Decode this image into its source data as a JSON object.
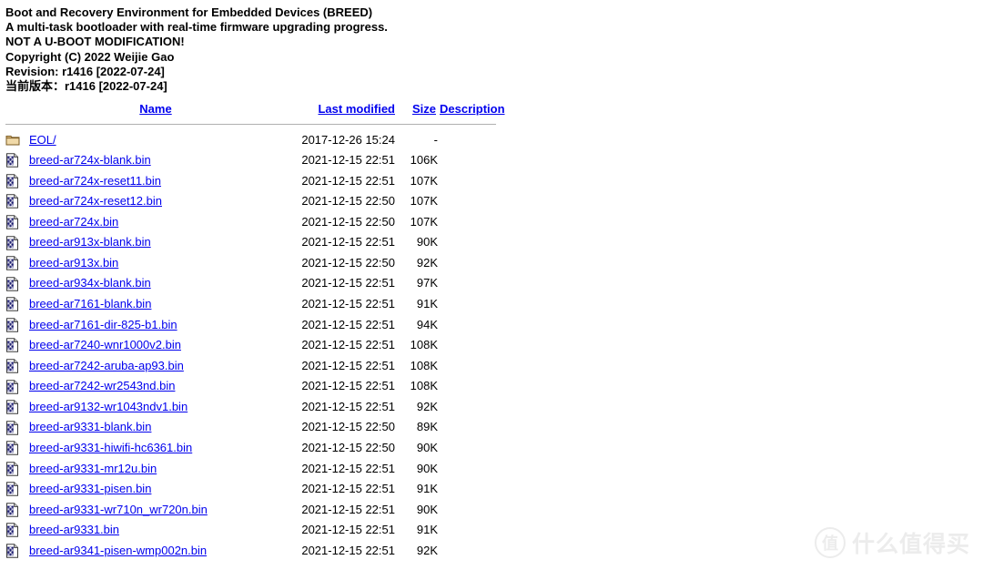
{
  "banner": {
    "lines": [
      "Boot and Recovery Environment for Embedded Devices (BREED)",
      "A multi-task bootloader with real-time firmware upgrading progress.",
      "NOT A U-BOOT MODIFICATION!",
      "Copyright (C) 2022 Weijie Gao",
      "Revision: r1416 [2022-07-24]",
      "当前版本：r1416 [2022-07-24]"
    ]
  },
  "table": {
    "headers": {
      "icon": "",
      "name": "Name",
      "last_modified": "Last modified",
      "size": "Size",
      "description": "Description"
    },
    "rows": [
      {
        "icon": "folder-icon",
        "name": "EOL/",
        "last_modified": "2017-12-26 15:24",
        "size": "-",
        "description": ""
      },
      {
        "icon": "binary-file-icon",
        "name": "breed-ar724x-blank.bin",
        "last_modified": "2021-12-15 22:51",
        "size": "106K",
        "description": ""
      },
      {
        "icon": "binary-file-icon",
        "name": "breed-ar724x-reset11.bin",
        "last_modified": "2021-12-15 22:51",
        "size": "107K",
        "description": ""
      },
      {
        "icon": "binary-file-icon",
        "name": "breed-ar724x-reset12.bin",
        "last_modified": "2021-12-15 22:50",
        "size": "107K",
        "description": ""
      },
      {
        "icon": "binary-file-icon",
        "name": "breed-ar724x.bin",
        "last_modified": "2021-12-15 22:50",
        "size": "107K",
        "description": ""
      },
      {
        "icon": "binary-file-icon",
        "name": "breed-ar913x-blank.bin",
        "last_modified": "2021-12-15 22:51",
        "size": "90K",
        "description": ""
      },
      {
        "icon": "binary-file-icon",
        "name": "breed-ar913x.bin",
        "last_modified": "2021-12-15 22:50",
        "size": "92K",
        "description": ""
      },
      {
        "icon": "binary-file-icon",
        "name": "breed-ar934x-blank.bin",
        "last_modified": "2021-12-15 22:51",
        "size": "97K",
        "description": ""
      },
      {
        "icon": "binary-file-icon",
        "name": "breed-ar7161-blank.bin",
        "last_modified": "2021-12-15 22:51",
        "size": "91K",
        "description": ""
      },
      {
        "icon": "binary-file-icon",
        "name": "breed-ar7161-dir-825-b1.bin",
        "last_modified": "2021-12-15 22:51",
        "size": "94K",
        "description": ""
      },
      {
        "icon": "binary-file-icon",
        "name": "breed-ar7240-wnr1000v2.bin",
        "last_modified": "2021-12-15 22:51",
        "size": "108K",
        "description": ""
      },
      {
        "icon": "binary-file-icon",
        "name": "breed-ar7242-aruba-ap93.bin",
        "last_modified": "2021-12-15 22:51",
        "size": "108K",
        "description": ""
      },
      {
        "icon": "binary-file-icon",
        "name": "breed-ar7242-wr2543nd.bin",
        "last_modified": "2021-12-15 22:51",
        "size": "108K",
        "description": ""
      },
      {
        "icon": "binary-file-icon",
        "name": "breed-ar9132-wr1043ndv1.bin",
        "last_modified": "2021-12-15 22:51",
        "size": "92K",
        "description": ""
      },
      {
        "icon": "binary-file-icon",
        "name": "breed-ar9331-blank.bin",
        "last_modified": "2021-12-15 22:50",
        "size": "89K",
        "description": ""
      },
      {
        "icon": "binary-file-icon",
        "name": "breed-ar9331-hiwifi-hc6361.bin",
        "last_modified": "2021-12-15 22:50",
        "size": "90K",
        "description": ""
      },
      {
        "icon": "binary-file-icon",
        "name": "breed-ar9331-mr12u.bin",
        "last_modified": "2021-12-15 22:51",
        "size": "90K",
        "description": ""
      },
      {
        "icon": "binary-file-icon",
        "name": "breed-ar9331-pisen.bin",
        "last_modified": "2021-12-15 22:51",
        "size": "91K",
        "description": ""
      },
      {
        "icon": "binary-file-icon",
        "name": "breed-ar9331-wr710n_wr720n.bin",
        "last_modified": "2021-12-15 22:51",
        "size": "90K",
        "description": ""
      },
      {
        "icon": "binary-file-icon",
        "name": "breed-ar9331.bin",
        "last_modified": "2021-12-15 22:51",
        "size": "91K",
        "description": ""
      },
      {
        "icon": "binary-file-icon",
        "name": "breed-ar9341-pisen-wmp002n.bin",
        "last_modified": "2021-12-15 22:51",
        "size": "92K",
        "description": ""
      }
    ]
  },
  "watermark": {
    "badge": "值",
    "text": "什么值得买"
  },
  "colors": {
    "link": "#0000ee",
    "text": "#000000",
    "rule": "#b0b0b0",
    "folder_icon": "#e8c88c",
    "watermark": "#ececec"
  }
}
